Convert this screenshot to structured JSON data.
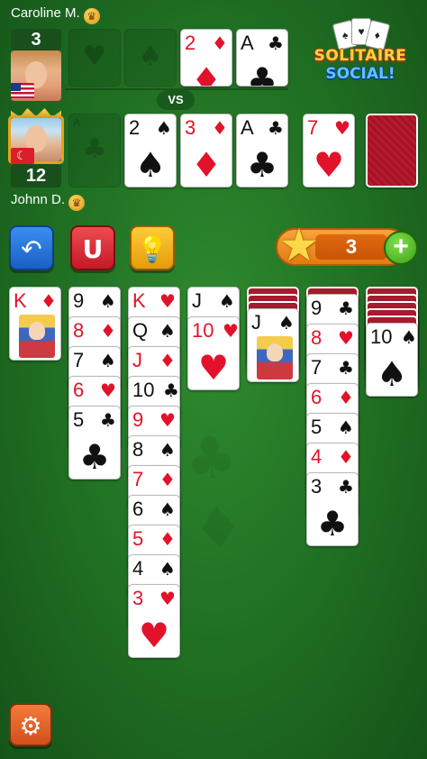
{
  "opponent": {
    "name": "Caroline M.",
    "score": "3"
  },
  "player": {
    "name": "Johnn D.",
    "score": "12"
  },
  "vs_label": "VS",
  "logo": {
    "line1": "SOLITAIRE",
    "line2": "SOCIAL!"
  },
  "stars": {
    "count": "3"
  },
  "icons": {
    "undo": "undo-icon",
    "magnet": "magnet-icon",
    "hint": "lightbulb-icon",
    "settings": "gear-icon",
    "star": "star-icon",
    "plus": "plus-icon"
  },
  "colors": {
    "felt": "#1f6e22",
    "red_suit": "#e2122a",
    "card_back": "#a81a2d"
  },
  "opponent_foundations": [
    {
      "type": "empty",
      "suit": "♥"
    },
    {
      "type": "empty",
      "suit": "♠"
    },
    {
      "type": "card",
      "rank": "2",
      "suit": "♦",
      "color": "red"
    },
    {
      "type": "card",
      "rank": "A",
      "suit": "♣",
      "color": "black"
    }
  ],
  "player_foundations": [
    {
      "type": "empty",
      "suit": "♣",
      "letter": "A"
    },
    {
      "type": "card",
      "rank": "2",
      "suit": "♠",
      "color": "black"
    },
    {
      "type": "card",
      "rank": "3",
      "suit": "♦",
      "color": "red"
    },
    {
      "type": "card",
      "rank": "A",
      "suit": "♣",
      "color": "black"
    }
  ],
  "waste": {
    "rank": "7",
    "suit": "♥",
    "color": "red"
  },
  "stock": {
    "type": "back"
  },
  "tableau": [
    {
      "hidden": 0,
      "cards": [
        {
          "rank": "K",
          "suit": "♦",
          "color": "red",
          "face": true
        }
      ]
    },
    {
      "hidden": 0,
      "cards": [
        {
          "rank": "9",
          "suit": "♠",
          "color": "black"
        },
        {
          "rank": "8",
          "suit": "♦",
          "color": "red"
        },
        {
          "rank": "7",
          "suit": "♠",
          "color": "black"
        },
        {
          "rank": "6",
          "suit": "♥",
          "color": "red"
        },
        {
          "rank": "5",
          "suit": "♣",
          "color": "black"
        }
      ]
    },
    {
      "hidden": 0,
      "cards": [
        {
          "rank": "K",
          "suit": "♥",
          "color": "red"
        },
        {
          "rank": "Q",
          "suit": "♠",
          "color": "black"
        },
        {
          "rank": "J",
          "suit": "♦",
          "color": "red"
        },
        {
          "rank": "10",
          "suit": "♣",
          "color": "black"
        },
        {
          "rank": "9",
          "suit": "♥",
          "color": "red"
        },
        {
          "rank": "8",
          "suit": "♠",
          "color": "black"
        },
        {
          "rank": "7",
          "suit": "♦",
          "color": "red"
        },
        {
          "rank": "6",
          "suit": "♠",
          "color": "black"
        },
        {
          "rank": "5",
          "suit": "♦",
          "color": "red"
        },
        {
          "rank": "4",
          "suit": "♠",
          "color": "black"
        },
        {
          "rank": "3",
          "suit": "♥",
          "color": "red"
        }
      ]
    },
    {
      "hidden": 0,
      "cards": [
        {
          "rank": "J",
          "suit": "♠",
          "color": "black"
        },
        {
          "rank": "10",
          "suit": "♥",
          "color": "red"
        }
      ]
    },
    {
      "hidden": 3,
      "cards": [
        {
          "rank": "J",
          "suit": "♠",
          "color": "black",
          "face": true
        }
      ]
    },
    {
      "hidden": 1,
      "cards": [
        {
          "rank": "9",
          "suit": "♣",
          "color": "black"
        },
        {
          "rank": "8",
          "suit": "♥",
          "color": "red"
        },
        {
          "rank": "7",
          "suit": "♣",
          "color": "black"
        },
        {
          "rank": "6",
          "suit": "♦",
          "color": "red"
        },
        {
          "rank": "5",
          "suit": "♠",
          "color": "black"
        },
        {
          "rank": "4",
          "suit": "♦",
          "color": "red"
        },
        {
          "rank": "3",
          "suit": "♣",
          "color": "black"
        }
      ]
    },
    {
      "hidden": 5,
      "cards": [
        {
          "rank": "10",
          "suit": "♠",
          "color": "black"
        }
      ]
    }
  ]
}
